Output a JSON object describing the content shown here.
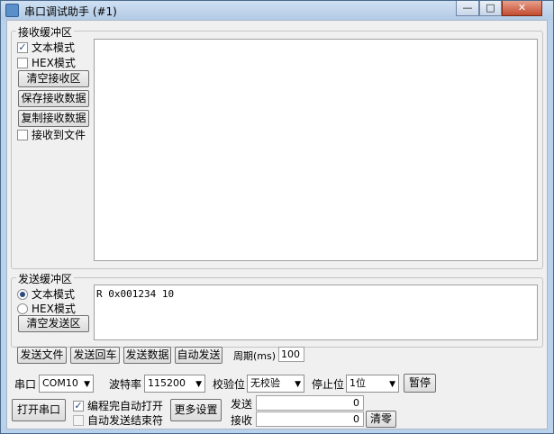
{
  "window": {
    "title": "串口调试助手 (#1)",
    "min": "—",
    "max": "□",
    "close": "✕"
  },
  "receive": {
    "group_label": "接收缓冲区",
    "text_mode": "文本模式",
    "hex_mode": "HEX模式",
    "clear": "清空接收区",
    "save": "保存接收数据",
    "copy": "复制接收数据",
    "to_file": "接收到文件",
    "text_mode_checked": true,
    "hex_mode_checked": false,
    "to_file_checked": false,
    "content": ""
  },
  "send": {
    "group_label": "发送缓冲区",
    "text_mode": "文本模式",
    "hex_mode": "HEX模式",
    "clear": "清空发送区",
    "content": "R 0x001234 10",
    "mode_selected": "text"
  },
  "actions": {
    "send_file": "发送文件",
    "send_return": "发送回车",
    "send_data": "发送数据",
    "auto_send": "自动发送",
    "period_label": "周期(ms)",
    "period_value": "100"
  },
  "settings": {
    "port_label": "串口",
    "port_value": "COM10",
    "baud_label": "波特率",
    "baud_value": "115200",
    "parity_label": "校验位",
    "parity_value": "无校验",
    "stop_label": "停止位",
    "stop_value": "1位",
    "pause": "暂停"
  },
  "bottom": {
    "open_port": "打开串口",
    "auto_open": "编程完自动打开",
    "auto_open_checked": true,
    "auto_end": "自动发送结束符",
    "auto_end_checked": false,
    "more_settings": "更多设置",
    "sent_label": "发送",
    "sent_value": "0",
    "recv_label": "接收",
    "recv_value": "0",
    "clear_counts": "清零"
  }
}
